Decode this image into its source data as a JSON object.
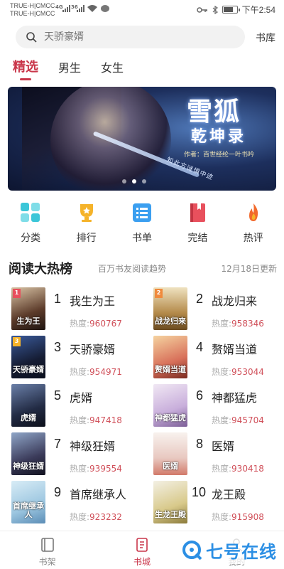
{
  "status_bar": {
    "carrier_1": "TRUE-H|CMCC",
    "carrier_2": "TRUE-H|CMCC",
    "signal_1": "4G",
    "signal_2": "36",
    "time": "下午2:54",
    "battery_level": 0.8,
    "icons": [
      "key-icon",
      "bluetooth-icon",
      "battery-icon",
      "wifi-icon",
      "message-icon"
    ]
  },
  "search": {
    "placeholder": "天骄豪婿",
    "shelf_link": "书库"
  },
  "tabs": [
    {
      "label": "精选",
      "active": true
    },
    {
      "label": "男生",
      "active": false
    },
    {
      "label": "女生",
      "active": false
    }
  ],
  "banner": {
    "title": "雪狐",
    "subtitle": "乾坤录",
    "author": "作者：百世经纶一叶书吟",
    "tagline": "知此方谜惧中迹",
    "slide_count": 3,
    "active_slide": 1
  },
  "quick_nav": [
    {
      "label": "分类",
      "icon": "category-icon",
      "color": "#3bc6d8"
    },
    {
      "label": "排行",
      "icon": "trophy-icon",
      "color": "#f5b32a"
    },
    {
      "label": "书单",
      "icon": "list-icon",
      "color": "#3b9ff0"
    },
    {
      "label": "完结",
      "icon": "book-icon",
      "color": "#e8505d"
    },
    {
      "label": "热评",
      "icon": "fire-icon",
      "color": "#f26a2c"
    }
  ],
  "ranking": {
    "title": "阅读大热榜",
    "subtitle": "百万书友阅读趋势",
    "date": "12月18日更新",
    "heat_label": "热度:",
    "books": [
      {
        "rank": "1",
        "name": "我生为王",
        "heat": "960767",
        "cover_text": "生为王"
      },
      {
        "rank": "2",
        "name": "战龙归来",
        "heat": "958346",
        "cover_text": "战龙归来"
      },
      {
        "rank": "3",
        "name": "天骄豪婿",
        "heat": "954971",
        "cover_text": "天骄豪婿"
      },
      {
        "rank": "4",
        "name": "赘婿当道",
        "heat": "953044",
        "cover_text": "赘婿当道"
      },
      {
        "rank": "5",
        "name": "虎婿",
        "heat": "947418",
        "cover_text": "虎婿"
      },
      {
        "rank": "6",
        "name": "神都猛虎",
        "heat": "945704",
        "cover_text": "神都猛虎"
      },
      {
        "rank": "7",
        "name": "神级狂婿",
        "heat": "939554",
        "cover_text": "神级狂婿"
      },
      {
        "rank": "8",
        "name": "医婿",
        "heat": "930418",
        "cover_text": "医婿"
      },
      {
        "rank": "9",
        "name": "首席继承人",
        "heat": "923232",
        "cover_text": "首席继承人"
      },
      {
        "rank": "10",
        "name": "龙王殿",
        "heat": "915908",
        "cover_text": "生龙王殿"
      }
    ]
  },
  "bottom_nav": [
    {
      "label": "书架",
      "icon": "bookshelf-icon",
      "active": false
    },
    {
      "label": "书城",
      "icon": "bookstore-icon",
      "active": true
    },
    {
      "label": "我的",
      "icon": "profile-icon",
      "active": false
    }
  ],
  "watermark": {
    "text": "七号在线"
  },
  "colors": {
    "accent": "#c9364a",
    "heat": "#d0505a",
    "watermark": "#2c8fe4"
  }
}
